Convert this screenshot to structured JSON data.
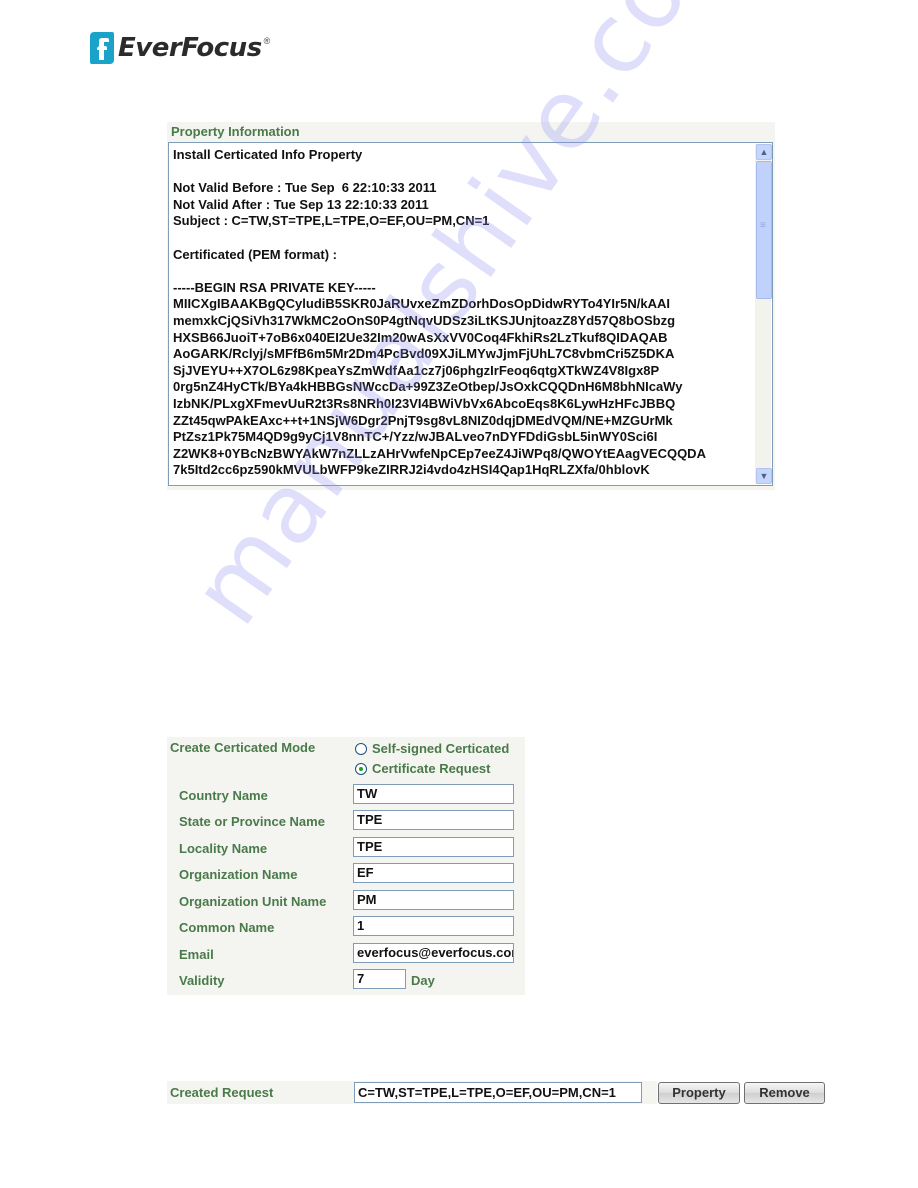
{
  "brand": {
    "name": "EverFocus",
    "registered_mark": "®",
    "accent_color": "#1aa3c9"
  },
  "property_info": {
    "title": "Property Information",
    "text": "Install Certicated Info Property\n\nNot Valid Before : Tue Sep  6 22:10:33 2011\nNot Valid After : Tue Sep 13 22:10:33 2011\nSubject : C=TW,ST=TPE,L=TPE,O=EF,OU=PM,CN=1\n\nCertificated (PEM format) :\n\n-----BEGIN RSA PRIVATE KEY-----\nMIICXgIBAAKBgQCyludiB5SKR0JaRUvxeZmZDorhDosOpDidwRYTo4YIr5N/kAAI\nmemxkCjQSiVh317WkMC2oOnS0P4gtNqvUDSz3iLtKSJUnjtoazZ8Yd57Q8bOSbzg\nHXSB66JuoiT+7oB6x040EI2Ue32Im20wAsXxVV0Coq4FkhiRs2LzTkuf8QIDAQAB\nAoGARK/Rclyj/sMFfB6m5Mr2Dm4PcBvd09XJiLMYwJjmFjUhL7C8vbmCri5Z5DKA\nSjJVEYU++X7OL6z98KpeaYsZmWdfAa1cz7j06phgzIrFeoq6qtgXTkWZ4V8Igx8P\n0rg5nZ4HyCTk/BYa4kHBBGsNWccDa+99Z3ZeOtbep/JsOxkCQQDnH6M8bhNIcaWy\nIzbNK/PLxgXFmevUuR2t3Rs8NRh0I23VI4BWiVbVx6AbcoEqs8K6LywHzHFcJBBQ\nZZt45qwPAkEAxc++t+1NSjW6Dgr2PnjT9sg8vL8NIZ0dqjDMEdVQM/NE+MZGUrMk\nPtZsz1Pk75M4QD9g9yCj1V8nnTC+/Yzz/wJBALveo7nDYFDdiGsbL5inWY0Sci6I\nZ2WK8+0YBcNzBWYAkW7nZLLzAHrVwfeNpCEp7eeZ4JiWPq8/QWOYtEAagVECQQDA\n7k5Itd2cc6pz590kMVULbWFP9keZIRRJ2i4vdo4zHSI4Qap1HqRLZXfa/0hblovK"
  },
  "create_mode": {
    "label": "Create Certicated Mode",
    "options": [
      {
        "label": "Self-signed Certicated",
        "checked": false
      },
      {
        "label": "Certificate Request",
        "checked": true
      }
    ],
    "fields": [
      {
        "label": "Country Name",
        "value": "TW"
      },
      {
        "label": "State or Province Name",
        "value": "TPE"
      },
      {
        "label": "Locality Name",
        "value": "TPE"
      },
      {
        "label": "Organization Name",
        "value": "EF"
      },
      {
        "label": "Organization Unit Name",
        "value": "PM"
      },
      {
        "label": "Common Name",
        "value": "1"
      },
      {
        "label": "Email",
        "value": "everfocus@everfocus.com"
      }
    ],
    "validity": {
      "label": "Validity",
      "value": "7",
      "unit": "Day"
    }
  },
  "created_request": {
    "label": "Created Request",
    "value": "C=TW,ST=TPE,L=TPE,O=EF,OU=PM,CN=1",
    "property_button": "Property",
    "remove_button": "Remove"
  },
  "watermark": "manualshive.com"
}
